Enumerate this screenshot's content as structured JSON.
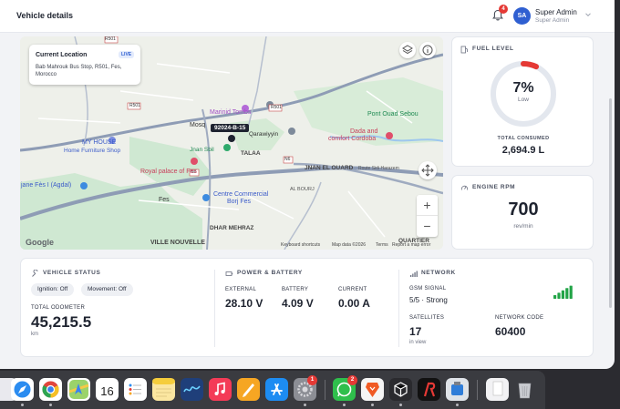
{
  "header": {
    "page_title": "Vehicle details",
    "notification_count": "4",
    "user_initials": "SA",
    "user_name": "Super Admin",
    "user_role": "Super Admin"
  },
  "map": {
    "location_title": "Current Location",
    "live_badge": "LIVE",
    "address": "Bab Mahrouk Bus Stop, R501, Fes, Morocco",
    "vehicle_plate": "92024-B-15",
    "labels": {
      "my_house": "MY HOUSE",
      "home_furniture": "Home Furniture Shop",
      "marinid_tombs": "Marinid Tombs",
      "mosque": "Mosq",
      "qarawiyyin": "Qarawiyyin",
      "jnan_sbil": "Jnan Sbil",
      "talaa": "TALAA",
      "jnan_el_ouard": "JNAN EL OUARD",
      "royal_palace": "Royal palace of Fes",
      "pont_ouad_sebou": "Pont Ouad Sebou",
      "dada": "Dada and",
      "comfort_cordoba": "comfort Cordoba",
      "jnane_fes": "jane Fès I (Agdal)",
      "fes": "Fes",
      "centre_commercial": "Centre Commercial",
      "borj_fes": "Borj Fes",
      "dhar_mehraz": "DHAR MEHRAZ",
      "ville_nouvelle": "VILLE NOUVELLE",
      "quartier": "QUARTIER",
      "al_bourj": "AL BOURJ",
      "road_r501": "R501",
      "road_n6": "N6",
      "road_n8": "N8",
      "road_r503": "R503",
      "road_sidi_harazem": "Route Sidi Harazem"
    },
    "google": "Google",
    "keyboard_shortcuts": "Keyboard shortcuts",
    "map_data": "Map data ©2026",
    "terms": "Terms",
    "report": "Report a map error",
    "zoom_in": "+",
    "zoom_out": "−"
  },
  "fuel": {
    "title": "FUEL LEVEL",
    "percent_value": 7,
    "percent_label": "7%",
    "status": "Low",
    "total_label": "TOTAL CONSUMED",
    "total_value": "2,694.9 L",
    "gauge_color": "#e53935",
    "track_color": "#e3e7ee"
  },
  "rpm": {
    "title": "ENGINE RPM",
    "value": "700",
    "unit": "rev/min"
  },
  "vehicle_status": {
    "title": "VEHICLE STATUS",
    "ignition": "Ignition: Off",
    "movement": "Movement: Off",
    "odometer_label": "TOTAL ODOMETER",
    "odometer_value": "45,215.5",
    "odometer_unit": "km"
  },
  "power": {
    "title": "POWER & BATTERY",
    "external_label": "EXTERNAL",
    "external_value": "28.10 V",
    "battery_label": "BATTERY",
    "battery_value": "4.09 V",
    "current_label": "CURRENT",
    "current_value": "0.00 A"
  },
  "network": {
    "title": "NETWORK",
    "gsm_label": "GSM SIGNAL",
    "gsm_value": "5/5 · Strong",
    "gsm_level": 5,
    "satellites_label": "SATELLITES",
    "satellites_value": "17",
    "satellites_unit": "in view",
    "network_code_label": "NETWORK CODE",
    "network_code_value": "60400",
    "signal_color": "#22a447"
  },
  "dock": {
    "calendar_day": "16",
    "settings_badge": "1",
    "whatsapp_badge": "2"
  }
}
